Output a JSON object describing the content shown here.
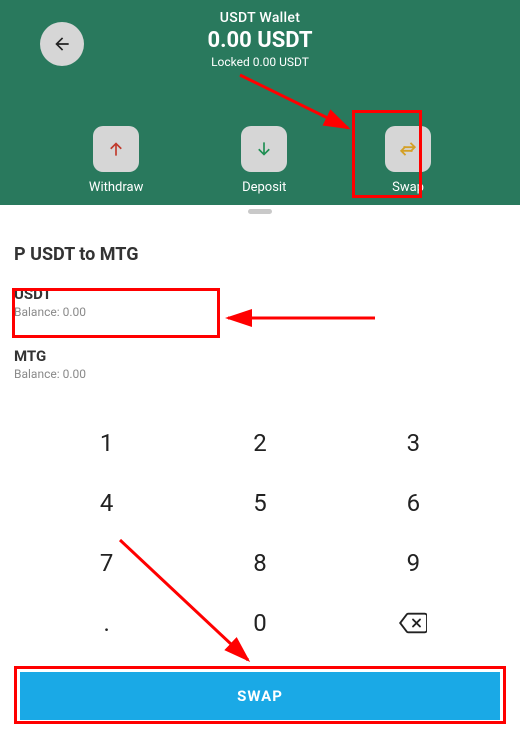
{
  "header": {
    "wallet_name": "USDT Wallet",
    "balance": "0.00 USDT",
    "locked": "Locked 0.00 USDT"
  },
  "actions": {
    "withdraw": "Withdraw",
    "deposit": "Deposit",
    "swap": "Swap"
  },
  "swap": {
    "title": "P USDT to MTG",
    "from_ccy": "USDT",
    "from_balance": "Balance: 0.00",
    "to_ccy": "MTG",
    "to_balance": "Balance: 0.00",
    "button": "SWAP"
  },
  "keypad": {
    "k1": "1",
    "k2": "2",
    "k3": "3",
    "k4": "4",
    "k5": "5",
    "k6": "6",
    "k7": "7",
    "k8": "8",
    "k9": "9",
    "kdot": ".",
    "k0": "0"
  },
  "colors": {
    "header_bg": "#29795d",
    "swap_btn": "#1aa9e6",
    "annotation": "#ff0000"
  }
}
